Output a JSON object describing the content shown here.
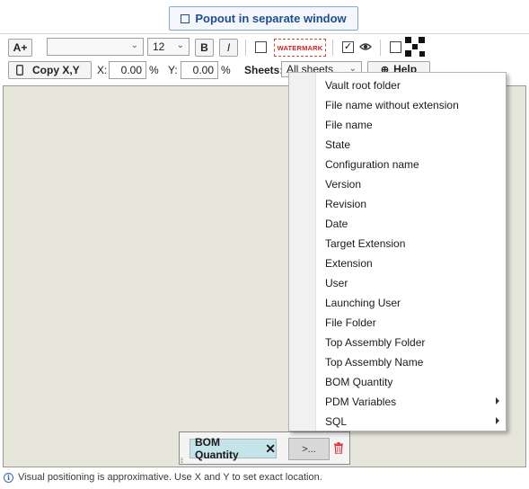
{
  "popout": {
    "label": "Popout in separate window"
  },
  "toolbar": {
    "increase_font_label": "A+",
    "font_family_value": "",
    "font_size_value": "12",
    "bold_label": "B",
    "italic_label": "I",
    "watermark_label": "WATERMARK",
    "copy_xy_label": "Copy X,Y",
    "x_label": "X:",
    "x_value": "0.00",
    "x_unit": "%",
    "y_label": "Y:",
    "y_value": "0.00",
    "y_unit": "%",
    "sheets_label": "Sheets:",
    "sheets_value": "All sheets",
    "help_label": "Help"
  },
  "field": {
    "tag_label": "BOM Quantity",
    "more_label": ">..."
  },
  "status": {
    "text": "Visual positioning is approximative. Use X and Y to set exact location."
  },
  "menu": {
    "items": [
      {
        "label": "Vault root folder",
        "has_submenu": false
      },
      {
        "label": "File name without extension",
        "has_submenu": false
      },
      {
        "label": "File name",
        "has_submenu": false
      },
      {
        "label": "State",
        "has_submenu": false
      },
      {
        "label": "Configuration name",
        "has_submenu": false
      },
      {
        "label": "Version",
        "has_submenu": false
      },
      {
        "label": "Revision",
        "has_submenu": false
      },
      {
        "label": "Date",
        "has_submenu": false
      },
      {
        "label": "Target Extension",
        "has_submenu": false
      },
      {
        "label": "Extension",
        "has_submenu": false
      },
      {
        "label": "User",
        "has_submenu": false
      },
      {
        "label": "Launching User",
        "has_submenu": false
      },
      {
        "label": "File Folder",
        "has_submenu": false
      },
      {
        "label": "Top Assembly Folder",
        "has_submenu": false
      },
      {
        "label": "Top Assembly Name",
        "has_submenu": false
      },
      {
        "label": "BOM Quantity",
        "has_submenu": false
      },
      {
        "label": "PDM Variables",
        "has_submenu": true
      },
      {
        "label": "SQL",
        "has_submenu": true
      }
    ]
  },
  "colors": {
    "canvas_bg": "#e6e6da",
    "accent_blue": "#1f4e8c",
    "watermark_red": "#d01f1f",
    "field_tag_bg": "#c4e4ea",
    "trash_red": "#d9363e"
  }
}
